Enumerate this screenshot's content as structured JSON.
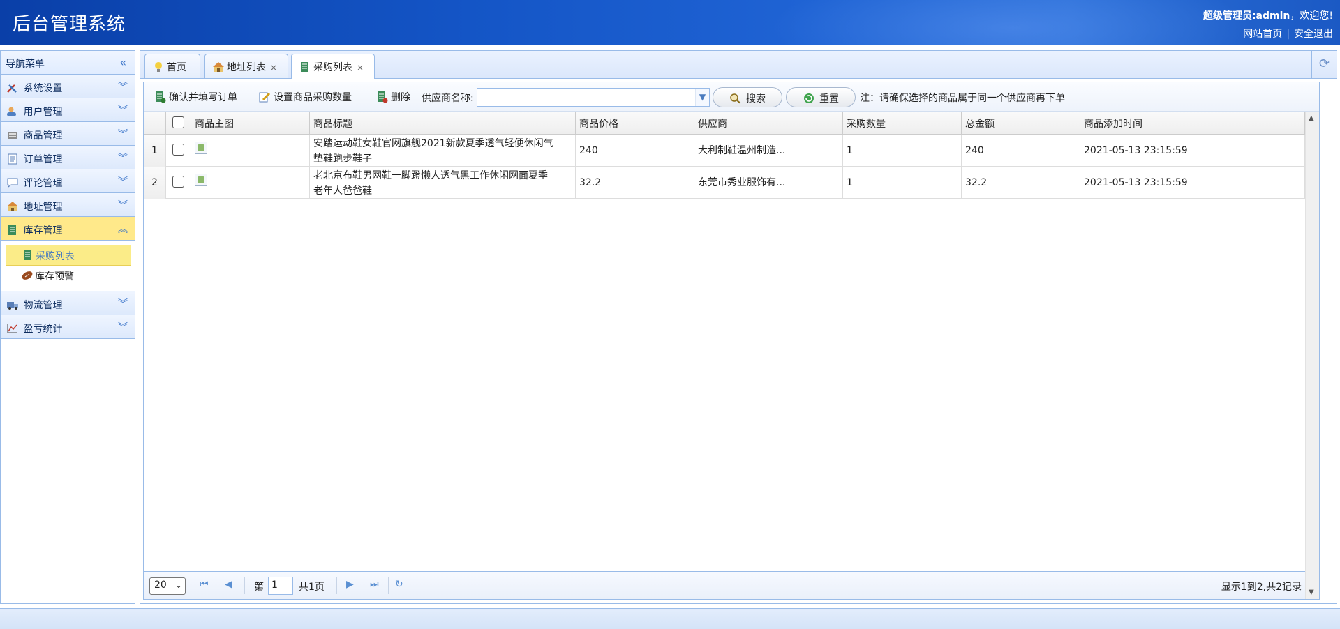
{
  "header": {
    "title": "后台管理系统",
    "welcome_role": "超级管理员:admin",
    "welcome_suffix": "，欢迎您!",
    "link_home": "网站首页",
    "link_sep": "|",
    "link_logout": "安全退出"
  },
  "sidebar": {
    "title": "导航菜单",
    "collapse_glyph": "«",
    "items": [
      {
        "label": "系统设置",
        "icon": "tools-icon",
        "chevron": "︾"
      },
      {
        "label": "用户管理",
        "icon": "users-icon",
        "chevron": "︾"
      },
      {
        "label": "商品管理",
        "icon": "goods-icon",
        "chevron": "︾"
      },
      {
        "label": "订单管理",
        "icon": "order-icon",
        "chevron": "︾"
      },
      {
        "label": "评论管理",
        "icon": "comment-icon",
        "chevron": "︾"
      },
      {
        "label": "地址管理",
        "icon": "house-icon",
        "chevron": "︾"
      },
      {
        "label": "库存管理",
        "icon": "inventory-icon",
        "chevron": "︽"
      },
      {
        "label": "物流管理",
        "icon": "truck-icon",
        "chevron": "︾"
      },
      {
        "label": "盈亏统计",
        "icon": "chart-icon",
        "chevron": "︾"
      }
    ],
    "sub_items": [
      {
        "label": "采购列表",
        "icon": "purchase-icon"
      },
      {
        "label": "库存预警",
        "icon": "football-icon"
      }
    ]
  },
  "tabs": [
    {
      "label": "首页",
      "icon": "lightbulb-icon",
      "close": ""
    },
    {
      "label": "地址列表",
      "icon": "house-icon",
      "close": "×"
    },
    {
      "label": "采购列表",
      "icon": "purchase-icon",
      "close": "×"
    }
  ],
  "toolbar": {
    "confirm_label": "确认并填写订单",
    "set_qty_label": "设置商品采购数量",
    "delete_label": "删除",
    "supplier_label": "供应商名称:",
    "supplier_value": "",
    "search_label": "搜索",
    "reset_label": "重置",
    "note": "注：请确保选择的商品属于同一个供应商再下单"
  },
  "grid": {
    "columns": [
      "商品主图",
      "商品标题",
      "商品价格",
      "供应商",
      "采购数量",
      "总金额",
      "商品添加时间"
    ],
    "rows": [
      {
        "num": "1",
        "title_line1": "安踏运动鞋女鞋官网旗舰2021新款夏季透气轻便休闲气",
        "title_line2": "垫鞋跑步鞋子",
        "price": "240",
        "supplier": "大利制鞋温州制造...",
        "qty": "1",
        "total": "240",
        "added": "2021-05-13 23:15:59"
      },
      {
        "num": "2",
        "title_line1": "老北京布鞋男网鞋一脚蹬懒人透气黑工作休闲网面夏季",
        "title_line2": "老年人爸爸鞋",
        "price": "32.2",
        "supplier": "东莞市秀业服饰有...",
        "qty": "1",
        "total": "32.2",
        "added": "2021-05-13 23:15:59"
      }
    ]
  },
  "pager": {
    "page_size": "20",
    "page_prefix": "第",
    "page_value": "1",
    "page_suffix": "共1页",
    "info": "显示1到2,共2记录"
  }
}
